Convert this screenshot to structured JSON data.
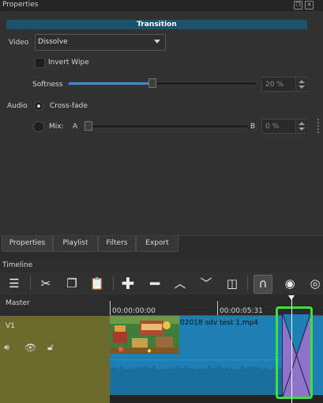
{
  "properties_panel": {
    "title": "Properties",
    "section_header": "Transition",
    "video": {
      "label": "Video",
      "selected": "Dissolve",
      "invert_wipe_label": "Invert Wipe",
      "invert_wipe_checked": false,
      "softness_label": "Softness",
      "softness_value_text": "20 %",
      "softness_value": 20
    },
    "audio": {
      "label": "Audio",
      "crossfade_label": "Cross-fade",
      "crossfade_selected": true,
      "mix_label": "Mix:",
      "mix_a": "A",
      "mix_b": "B",
      "mix_value_text": "0 %",
      "mix_value": 0
    }
  },
  "tabs": [
    "Properties",
    "Playlist",
    "Filters",
    "Export"
  ],
  "timeline": {
    "title": "Timeline",
    "toolbar_icons": [
      "menu-icon",
      "cut-icon",
      "copy-icon",
      "paste-icon",
      "append-icon",
      "remove-icon",
      "lift-icon",
      "overwrite-icon",
      "split-icon",
      "snap-icon",
      "scrub-icon",
      "ripple-icon"
    ],
    "master_label": "Master",
    "timecodes": [
      "00:00:00:00",
      "00:00:05:31"
    ],
    "tracks": [
      {
        "name": "V1",
        "clip_name": "02018 sdv test 1.mp4"
      }
    ]
  },
  "colors": {
    "accent_header": "#1a546c",
    "track_head": "#6c6a2c",
    "clip": "#1d7fb4",
    "transition": "#8f73c9",
    "selection": "#3ee03e"
  }
}
